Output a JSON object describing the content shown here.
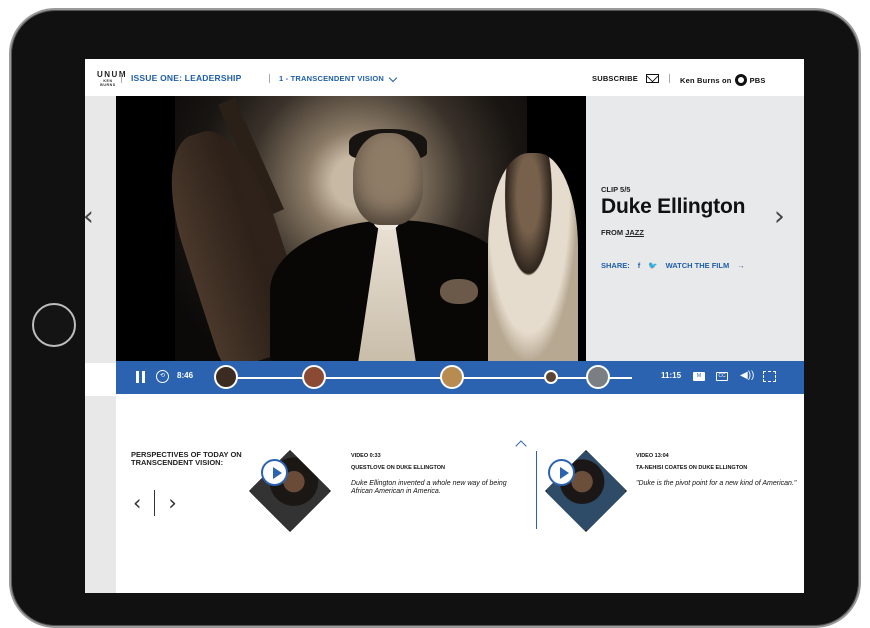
{
  "nav": {
    "logo_main": "UNUM",
    "logo_sub": "KEN BURNS",
    "issue": "ISSUE ONE: LEADERSHIP",
    "clip_selector": "1 - TRANSCENDENT VISION",
    "subscribe": "SUBSCRIBE",
    "ken_burns": "Ken Burns on",
    "pbs": "PBS"
  },
  "clip": {
    "counter": "CLIP 5/5",
    "title": "Duke Ellington",
    "from_prefix": "FROM",
    "from_link": "JAZZ",
    "share_label": "SHARE:",
    "facebook": "f",
    "twitter": "🐦",
    "watch_film": "WATCH THE FILM",
    "watch_arrow": "→"
  },
  "player": {
    "current_time": "8:46",
    "duration": "11:15",
    "caption_icon": "M",
    "cc_icon": "CC",
    "volume_icon": "speaker-icon"
  },
  "perspectives": {
    "heading": "PERSPECTIVES OF TODAY ON TRANSCENDENT VISION:",
    "cards": [
      {
        "meta": "VIDEO 0:33",
        "title": "QUESTLOVE ON DUKE ELLINGTON",
        "quote": "Duke Ellington invented a whole new way of being African American in America."
      },
      {
        "meta": "VIDEO 13:04",
        "title": "TA-NEHISI COATES ON DUKE ELLINGTON",
        "quote": "\"Duke is the pivot point for a new kind of American.\""
      }
    ]
  },
  "colors": {
    "accent": "#2B63B1",
    "panel": "#E8E9EA"
  }
}
